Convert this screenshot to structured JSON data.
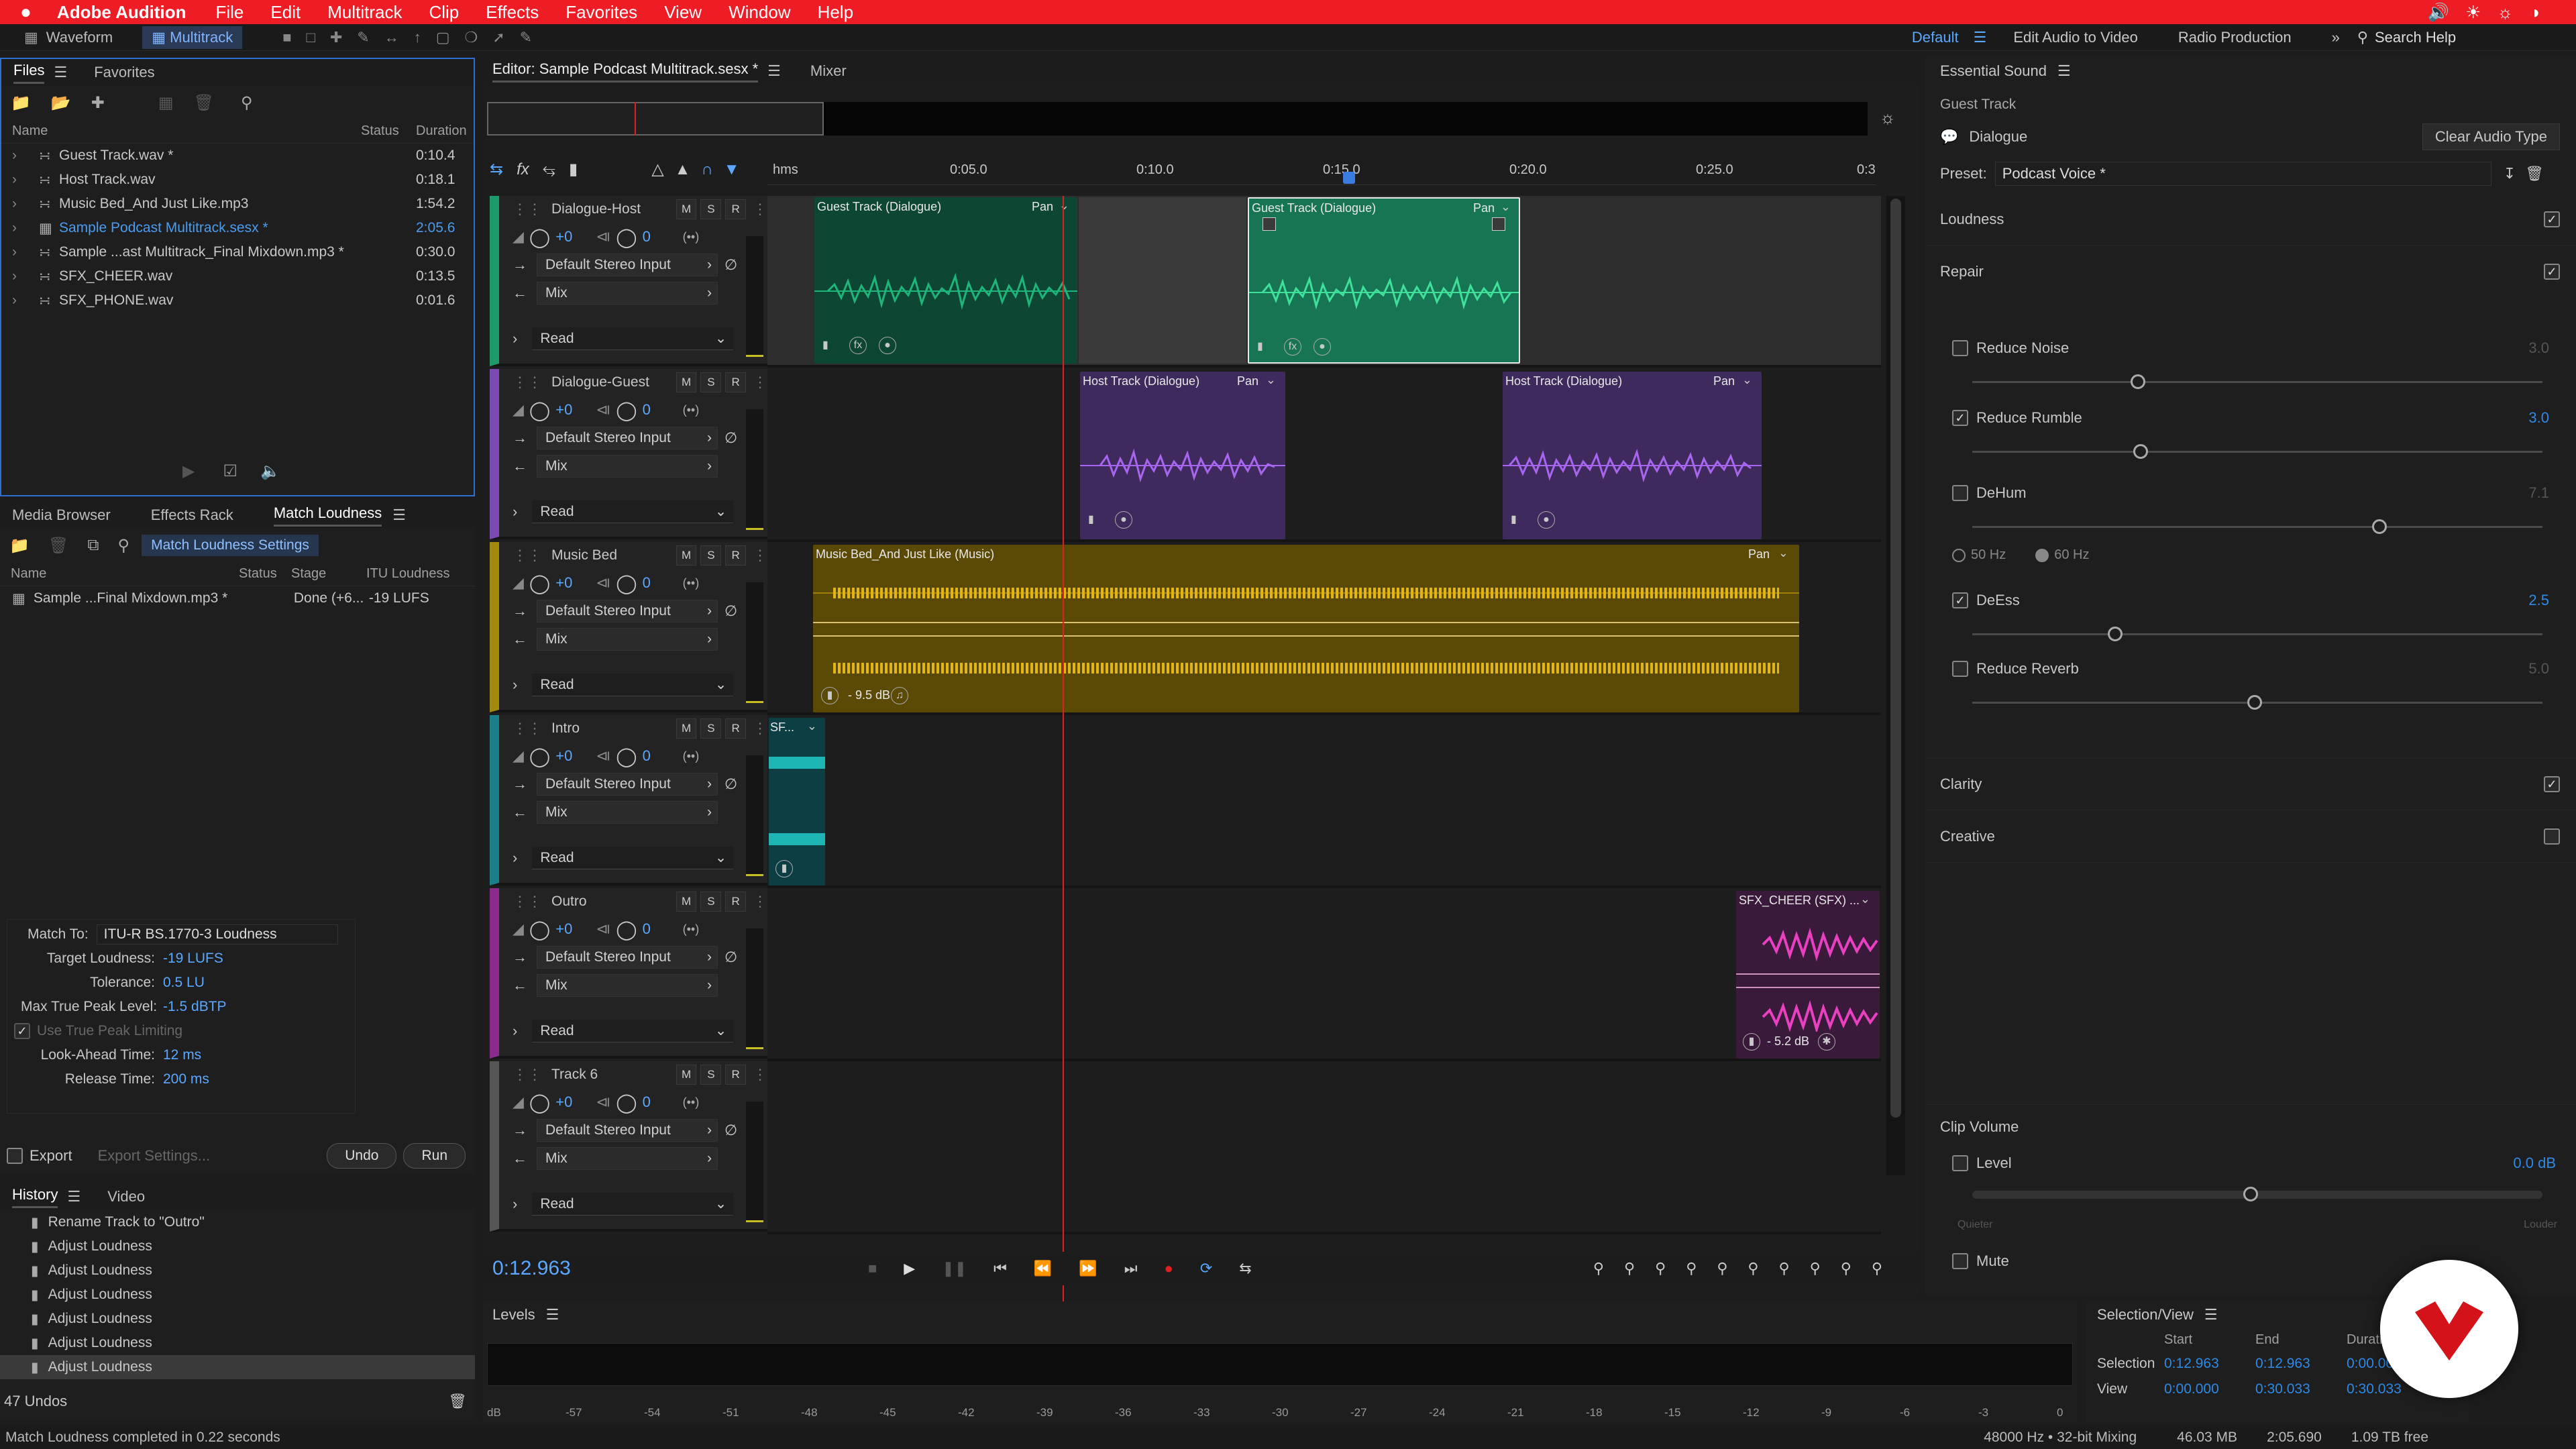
{
  "menu": {
    "apple": "",
    "app": "Adobe Audition",
    "items": [
      "File",
      "Edit",
      "Multitrack",
      "Clip",
      "Effects",
      "Favorites",
      "View",
      "Window",
      "Help"
    ]
  },
  "toolbar": {
    "waveform": "Waveform",
    "multitrack": "Multitrack",
    "workspace_default": "Default",
    "workspace_edit_video": "Edit Audio to Video",
    "workspace_radio": "Radio Production",
    "search_placeholder": "Search Help"
  },
  "files": {
    "tabs": [
      "Files",
      "Favorites"
    ],
    "col_name": "Name",
    "col_status": "Status",
    "col_duration": "Duration",
    "items": [
      {
        "name": "Guest Track.wav *",
        "duration": "0:10.4"
      },
      {
        "name": "Host Track.wav",
        "duration": "0:18.1"
      },
      {
        "name": "Music Bed_And Just Like.mp3",
        "duration": "1:54.2"
      },
      {
        "name": "Sample Podcast Multitrack.sesx *",
        "duration": "2:05.6"
      },
      {
        "name": "Sample ...ast Multitrack_Final Mixdown.mp3 *",
        "duration": "0:30.0"
      },
      {
        "name": "SFX_CHEER.wav",
        "duration": "0:13.5"
      },
      {
        "name": "SFX_PHONE.wav",
        "duration": "0:01.6"
      }
    ]
  },
  "loudness": {
    "tabs": [
      "Media Browser",
      "Effects Rack",
      "Match Loudness"
    ],
    "settings_btn": "Match Loudness Settings",
    "col_name": "Name",
    "col_status": "Status",
    "col_stage": "Stage",
    "col_itu": "ITU Loudness",
    "item_name": "Sample ...Final Mixdown.mp3 *",
    "item_stage": "Done (+6...",
    "item_itu": "-19 LUFS",
    "match_to_label": "Match To:",
    "match_to_value": "ITU-R BS.1770-3 Loudness",
    "target_label": "Target Loudness:",
    "target_value": "-19 LUFS",
    "tolerance_label": "Tolerance:",
    "tolerance_value": "0.5 LU",
    "peak_label": "Max True Peak Level:",
    "peak_value": "-1.5 dBTP",
    "true_peak_label": "Use True Peak Limiting",
    "lookahead_label": "Look-Ahead Time:",
    "lookahead_value": "12 ms",
    "release_label": "Release Time:",
    "release_value": "200 ms",
    "export_label": "Export",
    "export_settings": "Export Settings...",
    "undo": "Undo",
    "run": "Run"
  },
  "history": {
    "tabs": [
      "History",
      "Video"
    ],
    "items": [
      "Rename Track to \"Outro\"",
      "Adjust Loudness",
      "Adjust Loudness",
      "Adjust Loudness",
      "Adjust Loudness",
      "Adjust Loudness",
      "Adjust Loudness"
    ],
    "undos": "47 Undos"
  },
  "editor": {
    "tab_editor": "Editor: Sample Podcast Multitrack.sesx *",
    "tab_mixer": "Mixer",
    "ruler_unit": "hms",
    "ruler_labels": [
      "0:05.0",
      "0:10.0",
      "0:15.0",
      "0:20.0",
      "0:25.0",
      "0:3"
    ],
    "time": "0:12.963",
    "tracks": [
      {
        "name": "Dialogue-Host",
        "vol": "+0",
        "pan": "0",
        "input": "Default Stereo Input",
        "output": "Mix",
        "mode": "Read",
        "color": "#1f9a6a"
      },
      {
        "name": "Dialogue-Guest",
        "vol": "+0",
        "pan": "0",
        "input": "Default Stereo Input",
        "output": "Mix",
        "mode": "Read",
        "color": "#7a4ab0"
      },
      {
        "name": "Music Bed",
        "vol": "+0",
        "pan": "0",
        "input": "Default Stereo Input",
        "output": "Mix",
        "mode": "Read",
        "color": "#a08a10"
      },
      {
        "name": "Intro",
        "vol": "+0",
        "pan": "0",
        "input": "Default Stereo Input",
        "output": "Mix",
        "mode": "Read",
        "color": "#1a7f88"
      },
      {
        "name": "Outro",
        "vol": "+0",
        "pan": "0",
        "input": "Default Stereo Input",
        "output": "Mix",
        "mode": "Read",
        "color": "#8a2a8a"
      },
      {
        "name": "Track 6",
        "vol": "+0",
        "pan": "0",
        "input": "Default Stereo Input",
        "output": "Mix",
        "mode": "Read",
        "color": "#555555"
      }
    ],
    "track_buttons": [
      "M",
      "S",
      "R"
    ],
    "clips": {
      "guest1": "Guest Track (Dialogue)",
      "guest2": "Guest Track (Dialogue)",
      "host1": "Host Track (Dialogue)",
      "host2": "Host Track (Dialogue)",
      "music": "Music Bed_And Just Like (Music)",
      "music_vol": "- 9.5 dB",
      "intro": "SF...",
      "cheer": "SFX_CHEER (SFX) ...",
      "cheer_vol": "- 5.2 dB",
      "pan": "Pan"
    }
  },
  "levels": {
    "title": "Levels",
    "scale": [
      "dB",
      "-57",
      "-54",
      "-51",
      "-48",
      "-45",
      "-42",
      "-39",
      "-36",
      "-33",
      "-30",
      "-27",
      "-24",
      "-21",
      "-18",
      "-15",
      "-12",
      "-9",
      "-6",
      "-3",
      "0"
    ]
  },
  "selection": {
    "title": "Selection/View",
    "col_start": "Start",
    "col_end": "End",
    "col_duration": "Duration",
    "sel_label": "Selection",
    "sel_start": "0:12.963",
    "sel_end": "0:12.963",
    "sel_dur": "0:00.000",
    "view_label": "View",
    "view_start": "0:00.000",
    "view_end": "0:30.033",
    "view_dur": "0:30.033"
  },
  "essential": {
    "title": "Essential Sound",
    "subtitle": "Guest Track",
    "type": "Dialogue",
    "clear": "Clear Audio Type",
    "preset_label": "Preset:",
    "preset_value": "Podcast Voice *",
    "loudness": "Loudness",
    "repair": "Repair",
    "reduce_noise": "Reduce Noise",
    "reduce_noise_val": "3.0",
    "reduce_rumble": "Reduce Rumble",
    "reduce_rumble_val": "3.0",
    "dehum": "DeHum",
    "dehum_val": "7.1",
    "hz50": "50 Hz",
    "hz60": "60 Hz",
    "deess": "DeEss",
    "deess_val": "2.5",
    "reduce_reverb": "Reduce Reverb",
    "reduce_reverb_val": "5.0",
    "clarity": "Clarity",
    "creative": "Creative",
    "clip_volume": "Clip Volume",
    "level": "Level",
    "level_val": "0.0 dB",
    "quieter": "Quieter",
    "louder": "Louder",
    "mute": "Mute"
  },
  "status": {
    "message": "Match Loudness completed in 0.22 seconds",
    "format": "48000 Hz • 32-bit Mixing",
    "size": "46.03 MB",
    "duration": "2:05.690",
    "free": "1.09 TB free"
  },
  "colors": {
    "menu": "#ee1c24",
    "accent": "#2f8ae6",
    "guest": "#1fb57a",
    "host": "#a865ef",
    "music": "#e3b514",
    "intro": "#1fb5b5",
    "cheer": "#e840c0",
    "playhead": "#e02020"
  }
}
